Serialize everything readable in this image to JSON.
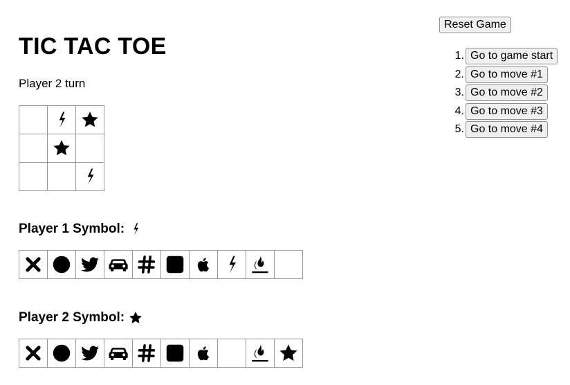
{
  "game": {
    "title": "TIC TAC TOE",
    "status": "Player 2 turn",
    "board": [
      "",
      "bolt",
      "star",
      "",
      "star",
      "",
      "",
      "",
      "bolt"
    ]
  },
  "player1": {
    "label": "Player 1 Symbol:",
    "current_symbol": "bolt",
    "options": [
      "times",
      "circle",
      "twitter",
      "car",
      "hashtag",
      "square",
      "apple",
      "bolt",
      "fire",
      ""
    ]
  },
  "player2": {
    "label": "Player 2 Symbol:",
    "current_symbol": "star",
    "options": [
      "times",
      "circle",
      "twitter",
      "car",
      "hashtag",
      "square",
      "apple",
      "",
      "fire",
      "star"
    ]
  },
  "controls": {
    "reset_label": "Reset Game"
  },
  "history": {
    "moves": [
      {
        "num": "1.",
        "label": "Go to game start"
      },
      {
        "num": "2.",
        "label": "Go to move #1"
      },
      {
        "num": "3.",
        "label": "Go to move #2"
      },
      {
        "num": "4.",
        "label": "Go to move #3"
      },
      {
        "num": "5.",
        "label": "Go to move #4"
      }
    ]
  }
}
